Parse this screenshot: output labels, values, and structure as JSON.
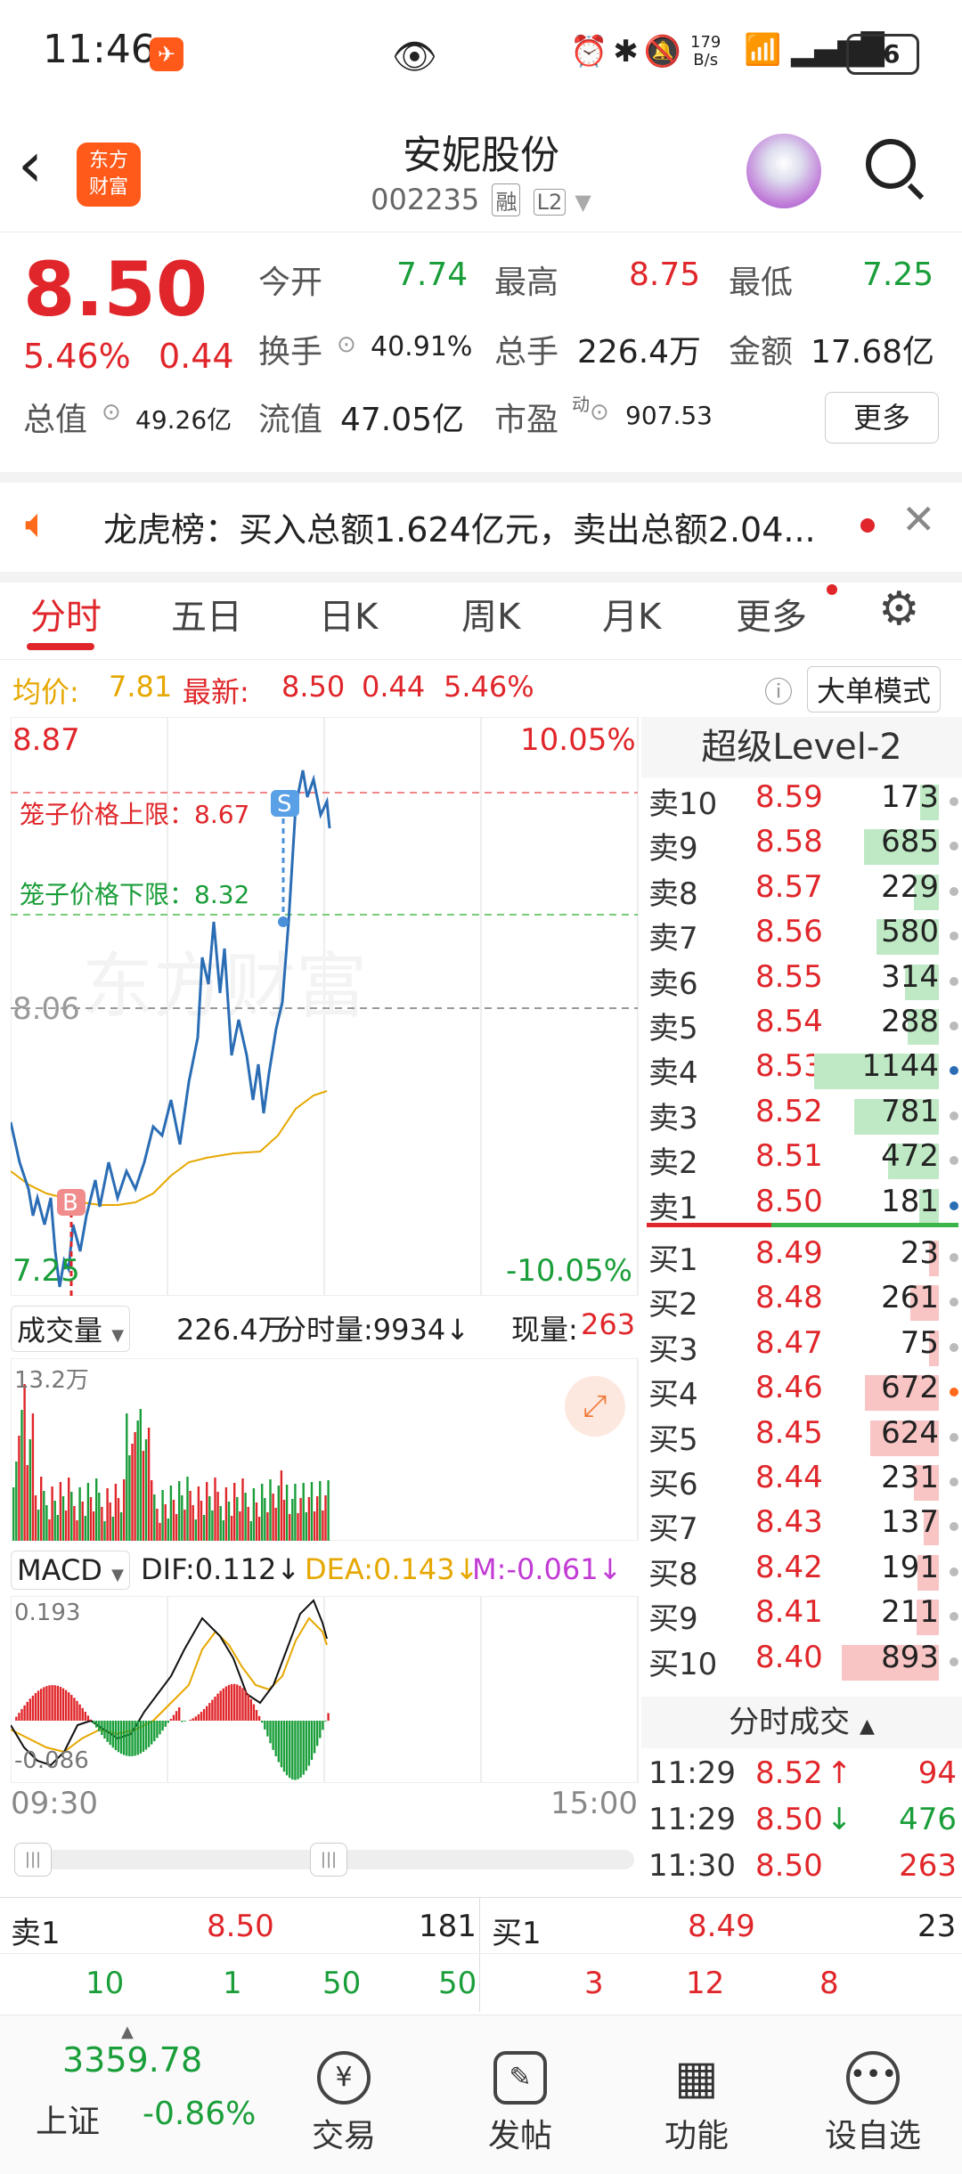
{
  "status": {
    "time": "11:46",
    "net_top": "179",
    "net_bottom": "B/s",
    "battery": "36"
  },
  "header": {
    "title": "安妮股份",
    "code": "002235",
    "tag1": "融",
    "tag2": "L2",
    "logo_top": "东方",
    "logo_bottom": "财富"
  },
  "quote": {
    "price": "8.50",
    "change_pct": "5.46%",
    "change_amt": "0.44",
    "open_label": "今开",
    "open": "7.74",
    "high_label": "最高",
    "high": "8.75",
    "low_label": "最低",
    "low": "7.25",
    "turnover_label": "换手",
    "turnover": "40.91%",
    "volume_label": "总手",
    "volume": "226.4万",
    "amount_label": "金额",
    "amount": "17.68亿",
    "mktcap_label": "总值",
    "mktcap": "49.26亿",
    "float_label": "流值",
    "float": "47.05亿",
    "pe_label": "市盈",
    "pe_sup": "动",
    "pe": "907.53",
    "more": "更多"
  },
  "news": {
    "text": "龙虎榜：买入总额1.624亿元，卖出总额2.04..."
  },
  "tabs": [
    "分时",
    "五日",
    "日K",
    "周K",
    "月K",
    "更多"
  ],
  "infoline": {
    "avg_label": "均价:",
    "avg": "7.81",
    "latest_label": "最新:",
    "latest": "8.50",
    "chg": "0.44",
    "pct": "5.46%",
    "mode_btn": "大单模式"
  },
  "chart": {
    "max": "8.87",
    "max_pct": "10.05%",
    "mid": "8.06",
    "min": "7.25",
    "min_pct": "-10.05%",
    "upper_limit": "笼子价格上限：8.67",
    "lower_limit": "笼子价格下限：8.32",
    "watermark": "东方财富",
    "marker_b": "B",
    "marker_s": "S",
    "vol_label": "成交量",
    "vol_total": "226.4万",
    "vol_tick": "分时量:9934↓",
    "vol_now_label": "现量:",
    "vol_now": "263",
    "vol_max": "13.2万",
    "macd_label": "MACD",
    "dif": "DIF:0.112↓",
    "dea": "DEA:0.143↓",
    "m": "M:-0.061↓",
    "macd_top": "0.193",
    "macd_bottom": "-0.086",
    "time_start": "09:30",
    "time_end": "15:00"
  },
  "book": {
    "title": "超级Level-2",
    "asks": [
      {
        "label": "卖10",
        "price": "8.59",
        "vol": "173",
        "bar": 0.15
      },
      {
        "label": "卖9",
        "price": "8.58",
        "vol": "685",
        "bar": 0.6
      },
      {
        "label": "卖8",
        "price": "8.57",
        "vol": "229",
        "bar": 0.2
      },
      {
        "label": "卖7",
        "price": "8.56",
        "vol": "580",
        "bar": 0.5
      },
      {
        "label": "卖6",
        "price": "8.55",
        "vol": "314",
        "bar": 0.27
      },
      {
        "label": "卖5",
        "price": "8.54",
        "vol": "288",
        "bar": 0.25
      },
      {
        "label": "卖4",
        "price": "8.53",
        "vol": "1144",
        "bar": 1.0
      },
      {
        "label": "卖3",
        "price": "8.52",
        "vol": "781",
        "bar": 0.68
      },
      {
        "label": "卖2",
        "price": "8.51",
        "vol": "472",
        "bar": 0.41
      },
      {
        "label": "卖1",
        "price": "8.50",
        "vol": "181",
        "bar": 0.16
      }
    ],
    "bids": [
      {
        "label": "买1",
        "price": "8.49",
        "vol": "23",
        "bar": 0.03
      },
      {
        "label": "买2",
        "price": "8.48",
        "vol": "261",
        "bar": 0.23
      },
      {
        "label": "买3",
        "price": "8.47",
        "vol": "75",
        "bar": 0.07
      },
      {
        "label": "买4",
        "price": "8.46",
        "vol": "672",
        "bar": 0.59
      },
      {
        "label": "买5",
        "price": "8.45",
        "vol": "624",
        "bar": 0.55
      },
      {
        "label": "买6",
        "price": "8.44",
        "vol": "231",
        "bar": 0.2
      },
      {
        "label": "买7",
        "price": "8.43",
        "vol": "137",
        "bar": 0.12
      },
      {
        "label": "买8",
        "price": "8.42",
        "vol": "191",
        "bar": 0.17
      },
      {
        "label": "买9",
        "price": "8.41",
        "vol": "211",
        "bar": 0.18
      },
      {
        "label": "买10",
        "price": "8.40",
        "vol": "893",
        "bar": 0.78
      }
    ],
    "trades_title": "分时成交",
    "trades": [
      {
        "time": "11:29",
        "price": "8.52",
        "arrow": "↑",
        "vol": "94"
      },
      {
        "time": "11:29",
        "price": "8.50",
        "arrow": "↓",
        "vol": "476"
      },
      {
        "time": "11:30",
        "price": "8.50",
        "arrow": "",
        "vol": "263"
      }
    ]
  },
  "bottomrow": {
    "sell_label": "卖1",
    "sell_price": "8.50",
    "sell_vol": "181",
    "buy_label": "买1",
    "buy_price": "8.49",
    "buy_vol": "23",
    "sell_split": [
      "10",
      "1",
      "50",
      "50"
    ],
    "buy_split": [
      "3",
      "12",
      "8"
    ]
  },
  "nav": {
    "index_value": "3359.78",
    "index_name": "上证",
    "index_pct": "-0.86%",
    "items": [
      "交易",
      "发帖",
      "功能",
      "设自选"
    ]
  }
}
